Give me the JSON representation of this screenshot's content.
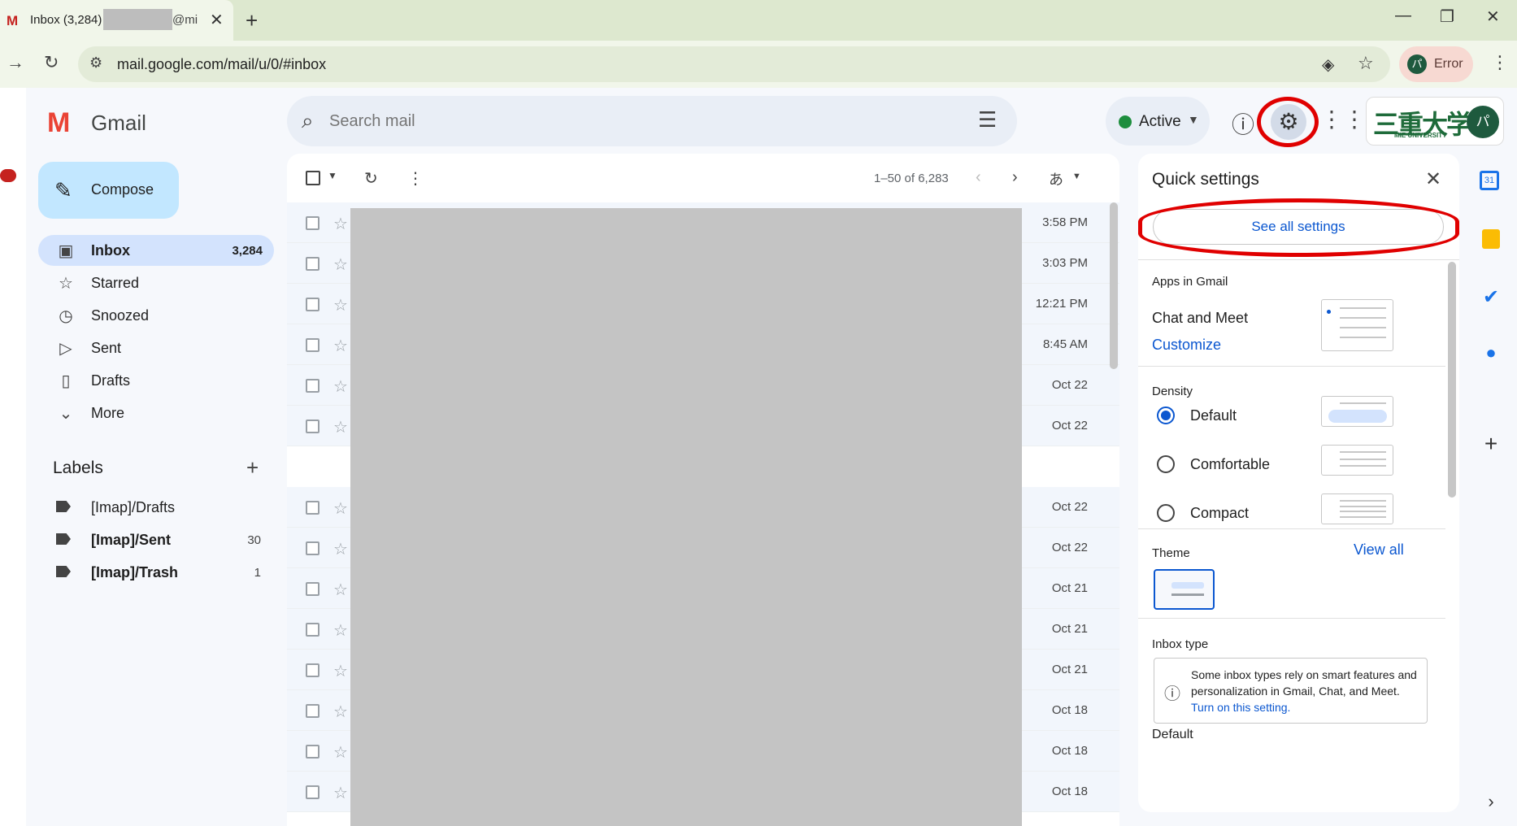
{
  "browser": {
    "tab_title": "Inbox (3,284)",
    "tab_email_fragment": "@mi",
    "url": "mail.google.com/mail/u/0/#inbox",
    "profile_status": "Error",
    "profile_initial": "パ"
  },
  "gmail": {
    "brand": "Gmail",
    "search_placeholder": "Search mail",
    "status_label": "Active",
    "university_logo": "三重大学",
    "university_sub": "MIE UNIVERSITY",
    "account_initial": "パ",
    "compose_label": "Compose",
    "nav": [
      {
        "label": "Inbox",
        "count": "3,284",
        "icon": "inbox-icon",
        "glyph": "▣",
        "selected": true
      },
      {
        "label": "Starred",
        "count": "",
        "icon": "star-icon",
        "glyph": "☆",
        "selected": false
      },
      {
        "label": "Snoozed",
        "count": "",
        "icon": "clock-icon",
        "glyph": "◷",
        "selected": false
      },
      {
        "label": "Sent",
        "count": "",
        "icon": "send-icon",
        "glyph": "▷",
        "selected": false
      },
      {
        "label": "Drafts",
        "count": "",
        "icon": "draft-icon",
        "glyph": "▯",
        "selected": false
      },
      {
        "label": "More",
        "count": "",
        "icon": "chevron-down-icon",
        "glyph": "⌄",
        "selected": false
      }
    ],
    "labels_heading": "Labels",
    "labels": [
      {
        "label": "[Imap]/Drafts",
        "count": "",
        "bold": false
      },
      {
        "label": "[Imap]/Sent",
        "count": "30",
        "bold": true
      },
      {
        "label": "[Imap]/Trash",
        "count": "1",
        "bold": true
      }
    ],
    "pager_text": "1–50 of 6,283",
    "input_tool": "あ",
    "mail_dates": [
      "3:58 PM",
      "3:03 PM",
      "12:21 PM",
      "8:45 AM",
      "Oct 22",
      "Oct 22",
      "Oct 22",
      "Oct 22",
      "Oct 21",
      "Oct 21",
      "Oct 21",
      "Oct 18",
      "Oct 18",
      "Oct 18"
    ]
  },
  "quick_settings": {
    "title": "Quick settings",
    "see_all": "See all settings",
    "apps_heading": "Apps in Gmail",
    "chat_meet": "Chat and Meet",
    "customize": "Customize",
    "density_heading": "Density",
    "density_options": [
      {
        "label": "Default",
        "selected": true
      },
      {
        "label": "Comfortable",
        "selected": false
      },
      {
        "label": "Compact",
        "selected": false
      }
    ],
    "theme_heading": "Theme",
    "view_all": "View all",
    "inbox_type_heading": "Inbox type",
    "inbox_note_text": "Some inbox types rely on smart features and personalization in Gmail, Chat, and Meet.",
    "inbox_note_link": "Turn on this setting.",
    "cut_off_label": "Default"
  },
  "side_rail": {
    "calendar_day": "31"
  },
  "colors": {
    "accent_blue": "#0b57d0",
    "highlight_red": "#e00000",
    "selected_nav": "#d3e3fd",
    "compose": "#c2e7ff"
  }
}
